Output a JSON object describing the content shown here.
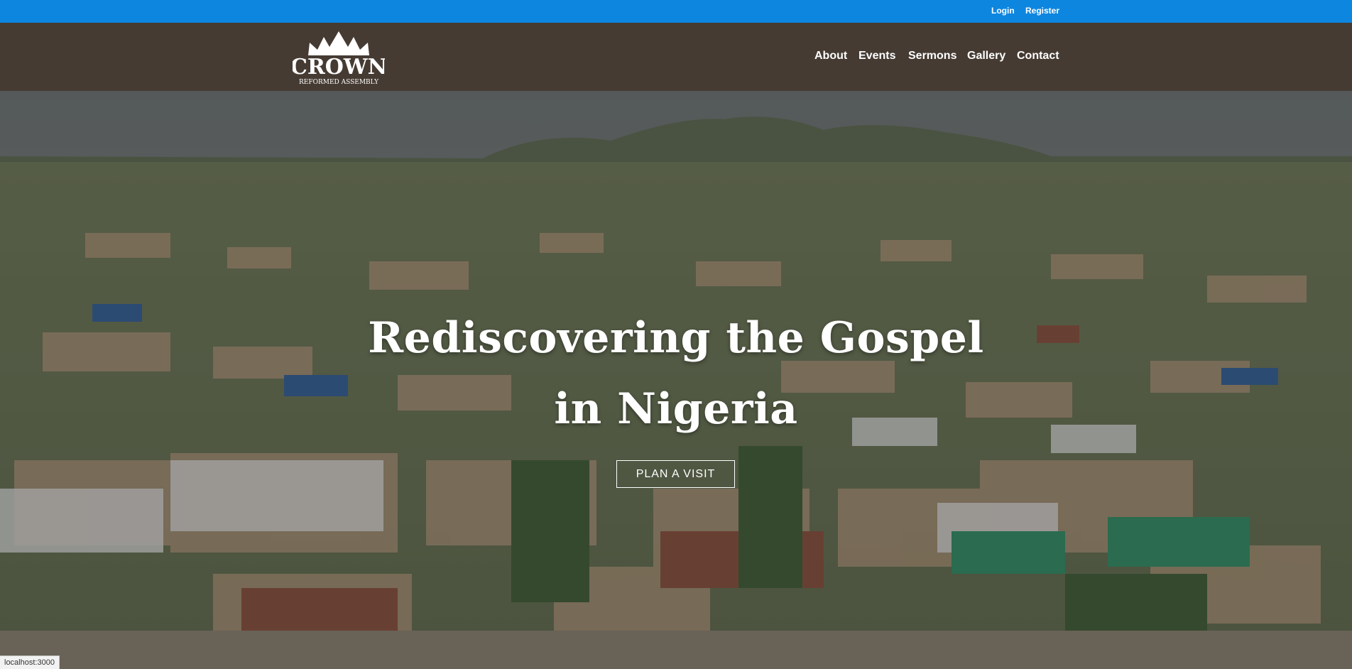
{
  "topbar": {
    "login": "Login",
    "register": "Register"
  },
  "logo": {
    "title": "CROWN",
    "subtitle": "REFORMED ASSEMBLY"
  },
  "nav": {
    "items": [
      "About",
      "Events",
      "Sermons",
      "Gallery",
      "Contact"
    ]
  },
  "hero": {
    "title_line1": "Rediscovering the Gospel",
    "title_line2": "in Nigeria",
    "cta": "PLAN A VISIT"
  },
  "status": {
    "url": "localhost:3000"
  },
  "colors": {
    "topbar": "#0d86e0",
    "navbar": "#453b33",
    "white": "#ffffff"
  }
}
